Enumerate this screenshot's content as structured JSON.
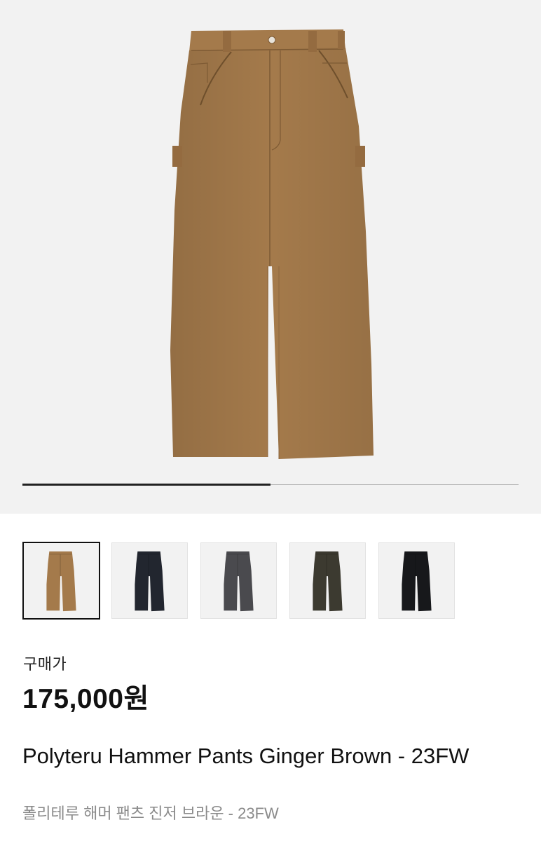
{
  "gallery": {
    "progress_fraction": 0.5,
    "main_image_color": "#a47a4b",
    "thumbnails": [
      {
        "name": "thumb-ginger-brown",
        "color": "#a47a4b",
        "selected": true
      },
      {
        "name": "thumb-navy",
        "color": "#22262f",
        "selected": false
      },
      {
        "name": "thumb-charcoal",
        "color": "#4a4a4e",
        "selected": false
      },
      {
        "name": "thumb-olive",
        "color": "#3c3a30",
        "selected": false
      },
      {
        "name": "thumb-black",
        "color": "#17181b",
        "selected": false
      }
    ]
  },
  "product": {
    "price_label": "구매가",
    "price": "175,000원",
    "title": "Polyteru Hammer Pants Ginger Brown - 23FW",
    "subtitle": "폴리테루 해머 팬츠 진저 브라운 - 23FW"
  }
}
